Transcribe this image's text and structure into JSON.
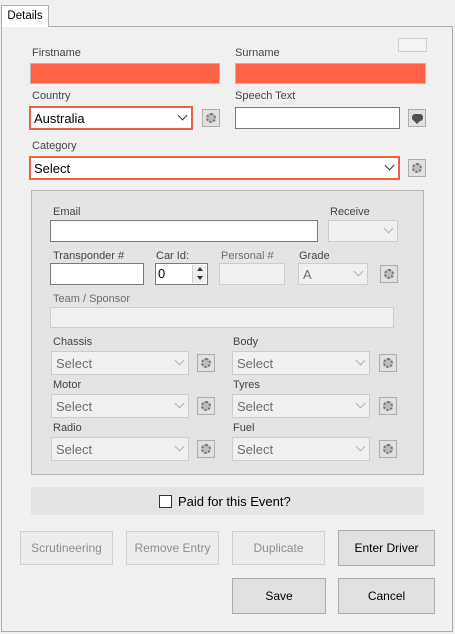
{
  "tabs": {
    "details": "Details"
  },
  "labels": {
    "firstname": "Firstname",
    "surname": "Surname",
    "country": "Country",
    "speech_text": "Speech Text",
    "category": "Category",
    "email": "Email",
    "receive": "Receive",
    "transponder": "Transponder #",
    "car_id": "Car Id:",
    "personal": "Personal #",
    "grade": "Grade",
    "team_sponsor": "Team / Sponsor",
    "chassis": "Chassis",
    "body": "Body",
    "motor": "Motor",
    "tyres": "Tyres",
    "radio": "Radio",
    "fuel": "Fuel"
  },
  "values": {
    "firstname": "",
    "surname": "",
    "country": "Australia",
    "speech_text": "",
    "category": "Select",
    "email": "",
    "receive": "",
    "transponder": "",
    "car_id": "0",
    "personal": "",
    "grade": "A",
    "team_sponsor": "",
    "chassis": "Select",
    "body": "Select",
    "motor": "Select",
    "tyres": "Select",
    "radio": "Select",
    "fuel": "Select"
  },
  "paid_for_event": {
    "label": "Paid for this Event?",
    "checked": false
  },
  "buttons": {
    "scrutineering": "Scrutineering",
    "remove_entry": "Remove Entry",
    "duplicate": "Duplicate",
    "enter_driver": "Enter Driver",
    "save": "Save",
    "cancel": "Cancel"
  },
  "colors": {
    "required_field": "#ff6347",
    "focus_border": "#e8623e",
    "background": "#f0f0f0"
  }
}
